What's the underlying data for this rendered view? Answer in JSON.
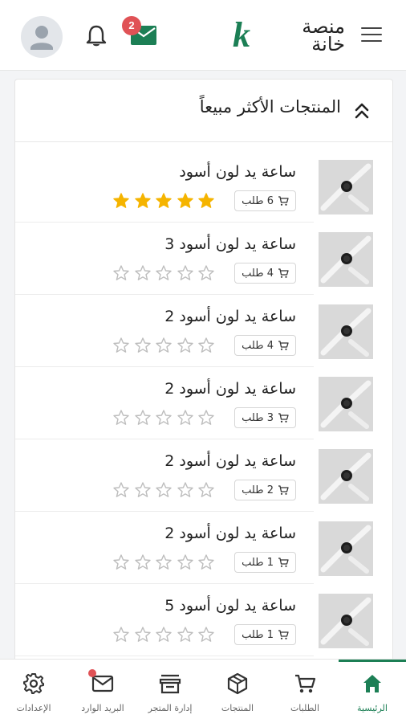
{
  "header": {
    "logo_mark": "k",
    "logo_text": "منصة خانة",
    "mail_badge": "2"
  },
  "section": {
    "title": "المنتجات الأكثر مبيعاً"
  },
  "products": [
    {
      "name": "ساعة يد لون أسود",
      "orders": "6 طلب",
      "rating": 5
    },
    {
      "name": "ساعة يد لون أسود 3",
      "orders": "4 طلب",
      "rating": 0
    },
    {
      "name": "ساعة يد لون أسود 2",
      "orders": "4 طلب",
      "rating": 0
    },
    {
      "name": "ساعة يد لون أسود 2",
      "orders": "3 طلب",
      "rating": 0
    },
    {
      "name": "ساعة يد لون أسود 2",
      "orders": "2 طلب",
      "rating": 0
    },
    {
      "name": "ساعة يد لون أسود 2",
      "orders": "1 طلب",
      "rating": 0
    },
    {
      "name": "ساعة يد لون أسود 5",
      "orders": "1 طلب",
      "rating": 0
    }
  ],
  "nav": {
    "home": "الرئيسية",
    "orders": "الطلبات",
    "products": "المنتجات",
    "store": "إدارة المتجر",
    "inbox": "البريد الوارد",
    "settings": "الإعدادات"
  },
  "colors": {
    "brand": "#1c7f55",
    "badge": "#e05256",
    "star_filled": "#f5b400",
    "star_empty": "#bdbdbd"
  }
}
